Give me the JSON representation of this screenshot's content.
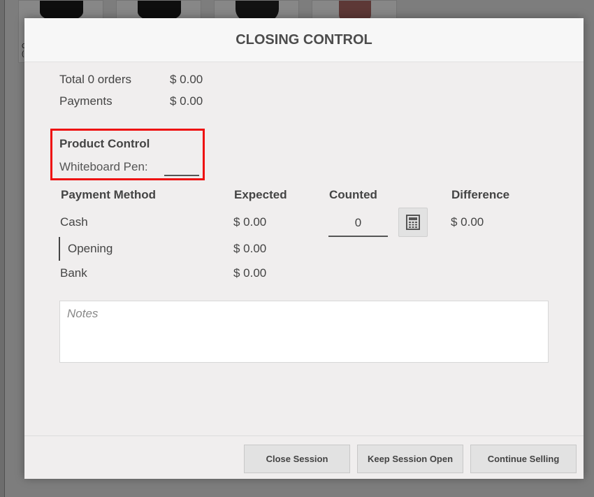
{
  "background": {
    "tiles": [
      {
        "label": "C\n(C"
      },
      {
        "label": ""
      },
      {
        "label": ""
      },
      {
        "label": ""
      }
    ]
  },
  "modal": {
    "title": "CLOSING CONTROL",
    "summary": [
      {
        "label": "Total 0 orders",
        "amount": "$ 0.00"
      },
      {
        "label": "Payments",
        "amount": "$ 0.00"
      }
    ],
    "product_control": {
      "title": "Product Control",
      "item_label": "Whiteboard Pen:",
      "highlight_color": "#ee1111"
    },
    "table": {
      "headers": [
        "Payment Method",
        "Expected",
        "Counted",
        "Difference"
      ],
      "rows": [
        {
          "method": "Cash",
          "expected": "$ 0.00",
          "counted": "0",
          "difference": "$ 0.00"
        },
        {
          "method": "Opening",
          "expected": "$ 0.00"
        },
        {
          "method": "Bank",
          "expected": "$ 0.00"
        }
      ]
    },
    "notes": {
      "placeholder": "Notes"
    },
    "footer": {
      "close_label": "Close Session",
      "keep_open_label": "Keep Session Open",
      "continue_label": "Continue Selling"
    }
  }
}
